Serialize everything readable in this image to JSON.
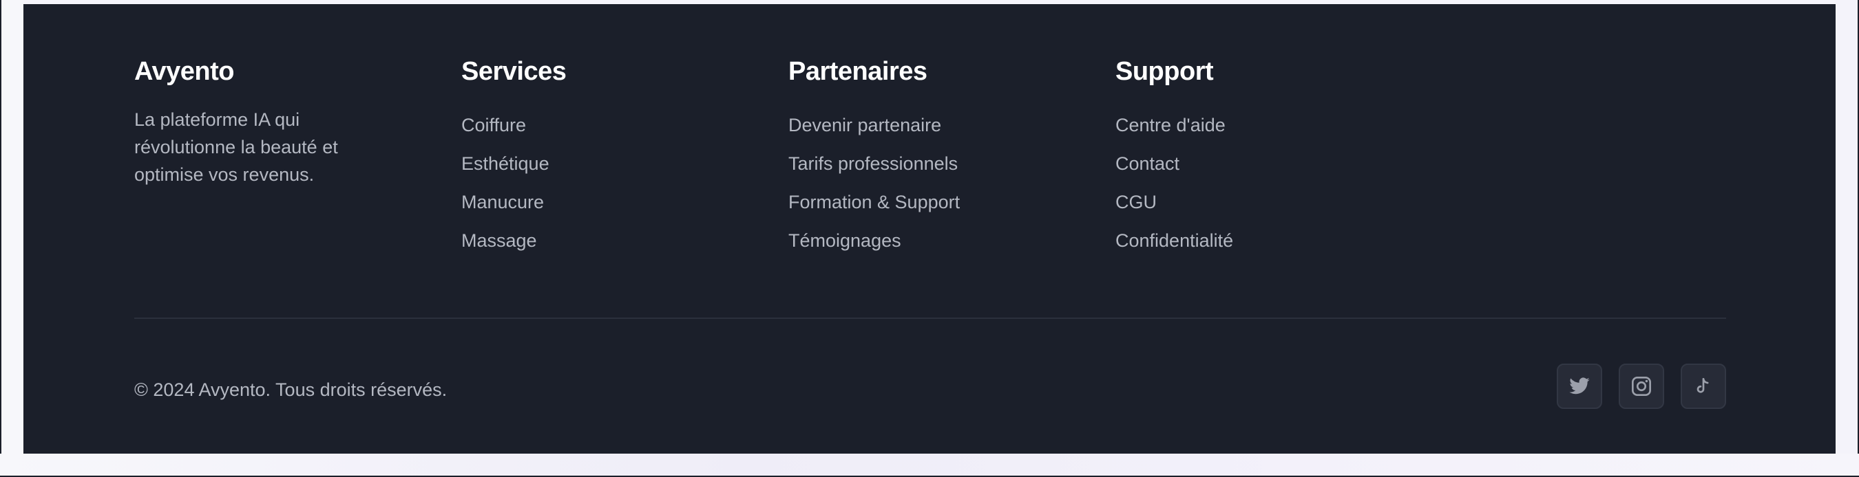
{
  "brand": {
    "name": "Avyento",
    "tagline": "La plateforme IA qui révolutionne la beauté et optimise vos revenus."
  },
  "columns": [
    {
      "title": "Services",
      "links": [
        "Coiffure",
        "Esthétique",
        "Manucure",
        "Massage"
      ]
    },
    {
      "title": "Partenaires",
      "links": [
        "Devenir partenaire",
        "Tarifs professionnels",
        "Formation & Support",
        "Témoignages"
      ]
    },
    {
      "title": "Support",
      "links": [
        "Centre d'aide",
        "Contact",
        "CGU",
        "Confidentialité"
      ]
    }
  ],
  "bottom": {
    "copyright": "© 2024 Avyento. Tous droits réservés."
  },
  "socials": [
    {
      "icon": "twitter-icon"
    },
    {
      "icon": "instagram-icon"
    },
    {
      "icon": "tiktok-icon"
    }
  ],
  "colors": {
    "footer_background": "#1b1f2a",
    "heading": "#ffffff",
    "text": "#b4b8c2",
    "social_button": "#272b37",
    "icon": "#9ca0ab"
  }
}
